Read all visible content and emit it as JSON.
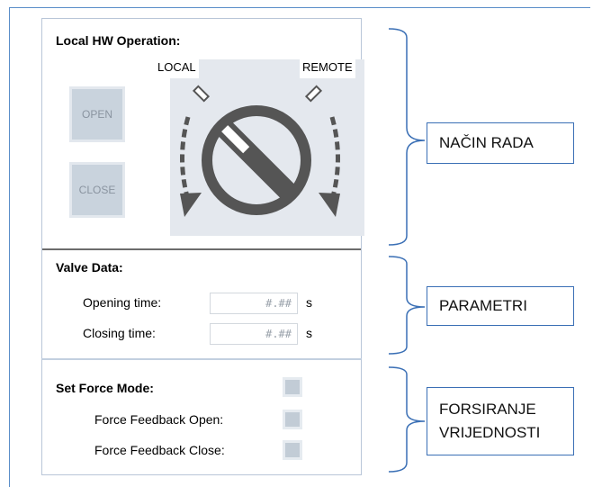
{
  "local_hw": {
    "title": "Local HW Operation:",
    "open_label": "OPEN",
    "close_label": "CLOSE",
    "local_label": "LOCAL",
    "remote_label": "REMOTE"
  },
  "valve_data": {
    "title": "Valve Data:",
    "opening_label": "Opening time:",
    "opening_value": "#.##",
    "closing_label": "Closing time:",
    "closing_value": "#.##",
    "unit": "s"
  },
  "force_mode": {
    "title": "Set Force Mode:",
    "feedback_open_label": "Force Feedback Open:",
    "feedback_close_label": "Force Feedback Close:"
  },
  "callouts": {
    "nacin_rada": "NAČIN RADA",
    "parametri": "PARAMETRI",
    "forsiranje_line1": "FORSIRANJE",
    "forsiranje_line2": "VRIJEDNOSTI"
  },
  "colors": {
    "frame_blue": "#5b8ec9",
    "callout_border": "#3a6fb5",
    "switch_gray": "#555555",
    "button_fill": "#c9d3dd"
  }
}
